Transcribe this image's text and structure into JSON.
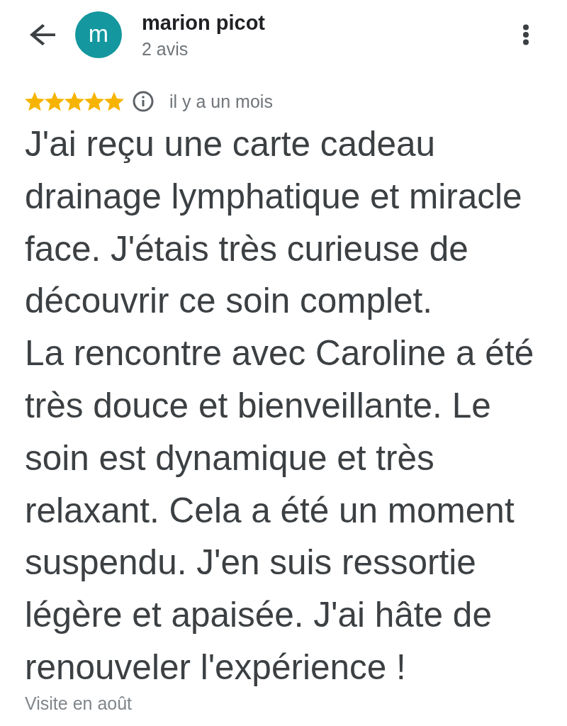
{
  "header": {
    "avatar_letter": "m",
    "name": "marion picot",
    "subtitle": "2 avis"
  },
  "review": {
    "stars": 5,
    "time": "il y a un mois",
    "paragraphs": [
      "J'ai reçu une carte cadeau drainage lymphatique et miracle face. J'étais très curieuse de découvrir ce soin complet.",
      "La rencontre avec Caroline a été très douce et bienveillante. Le soin est dynamique et très relaxant. Cela a été un moment suspendu. J'en suis ressortie légère et apaisée. J'ai hâte de renouveler l'expérience !"
    ],
    "visit": "Visite en août"
  }
}
